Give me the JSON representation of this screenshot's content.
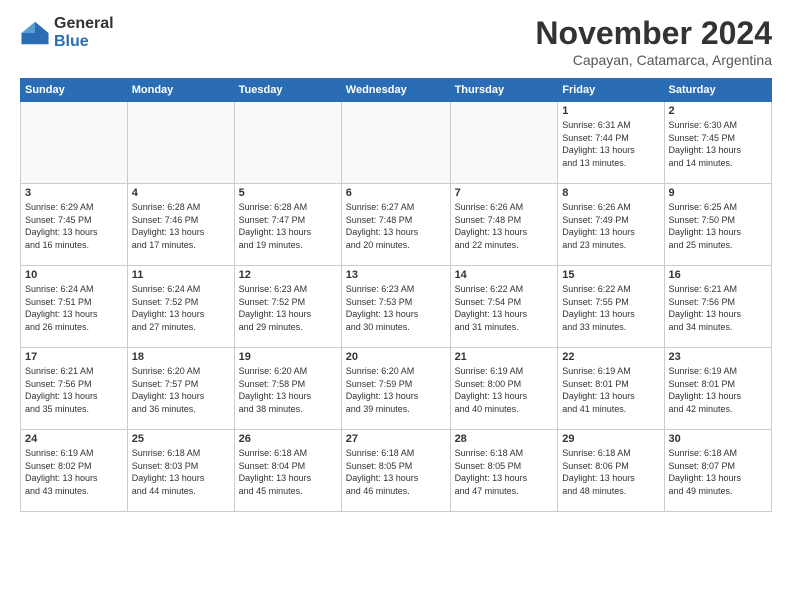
{
  "logo": {
    "general": "General",
    "blue": "Blue"
  },
  "header": {
    "month": "November 2024",
    "location": "Capayan, Catamarca, Argentina"
  },
  "weekdays": [
    "Sunday",
    "Monday",
    "Tuesday",
    "Wednesday",
    "Thursday",
    "Friday",
    "Saturday"
  ],
  "weeks": [
    [
      {
        "day": "",
        "info": ""
      },
      {
        "day": "",
        "info": ""
      },
      {
        "day": "",
        "info": ""
      },
      {
        "day": "",
        "info": ""
      },
      {
        "day": "",
        "info": ""
      },
      {
        "day": "1",
        "info": "Sunrise: 6:31 AM\nSunset: 7:44 PM\nDaylight: 13 hours\nand 13 minutes."
      },
      {
        "day": "2",
        "info": "Sunrise: 6:30 AM\nSunset: 7:45 PM\nDaylight: 13 hours\nand 14 minutes."
      }
    ],
    [
      {
        "day": "3",
        "info": "Sunrise: 6:29 AM\nSunset: 7:45 PM\nDaylight: 13 hours\nand 16 minutes."
      },
      {
        "day": "4",
        "info": "Sunrise: 6:28 AM\nSunset: 7:46 PM\nDaylight: 13 hours\nand 17 minutes."
      },
      {
        "day": "5",
        "info": "Sunrise: 6:28 AM\nSunset: 7:47 PM\nDaylight: 13 hours\nand 19 minutes."
      },
      {
        "day": "6",
        "info": "Sunrise: 6:27 AM\nSunset: 7:48 PM\nDaylight: 13 hours\nand 20 minutes."
      },
      {
        "day": "7",
        "info": "Sunrise: 6:26 AM\nSunset: 7:48 PM\nDaylight: 13 hours\nand 22 minutes."
      },
      {
        "day": "8",
        "info": "Sunrise: 6:26 AM\nSunset: 7:49 PM\nDaylight: 13 hours\nand 23 minutes."
      },
      {
        "day": "9",
        "info": "Sunrise: 6:25 AM\nSunset: 7:50 PM\nDaylight: 13 hours\nand 25 minutes."
      }
    ],
    [
      {
        "day": "10",
        "info": "Sunrise: 6:24 AM\nSunset: 7:51 PM\nDaylight: 13 hours\nand 26 minutes."
      },
      {
        "day": "11",
        "info": "Sunrise: 6:24 AM\nSunset: 7:52 PM\nDaylight: 13 hours\nand 27 minutes."
      },
      {
        "day": "12",
        "info": "Sunrise: 6:23 AM\nSunset: 7:52 PM\nDaylight: 13 hours\nand 29 minutes."
      },
      {
        "day": "13",
        "info": "Sunrise: 6:23 AM\nSunset: 7:53 PM\nDaylight: 13 hours\nand 30 minutes."
      },
      {
        "day": "14",
        "info": "Sunrise: 6:22 AM\nSunset: 7:54 PM\nDaylight: 13 hours\nand 31 minutes."
      },
      {
        "day": "15",
        "info": "Sunrise: 6:22 AM\nSunset: 7:55 PM\nDaylight: 13 hours\nand 33 minutes."
      },
      {
        "day": "16",
        "info": "Sunrise: 6:21 AM\nSunset: 7:56 PM\nDaylight: 13 hours\nand 34 minutes."
      }
    ],
    [
      {
        "day": "17",
        "info": "Sunrise: 6:21 AM\nSunset: 7:56 PM\nDaylight: 13 hours\nand 35 minutes."
      },
      {
        "day": "18",
        "info": "Sunrise: 6:20 AM\nSunset: 7:57 PM\nDaylight: 13 hours\nand 36 minutes."
      },
      {
        "day": "19",
        "info": "Sunrise: 6:20 AM\nSunset: 7:58 PM\nDaylight: 13 hours\nand 38 minutes."
      },
      {
        "day": "20",
        "info": "Sunrise: 6:20 AM\nSunset: 7:59 PM\nDaylight: 13 hours\nand 39 minutes."
      },
      {
        "day": "21",
        "info": "Sunrise: 6:19 AM\nSunset: 8:00 PM\nDaylight: 13 hours\nand 40 minutes."
      },
      {
        "day": "22",
        "info": "Sunrise: 6:19 AM\nSunset: 8:01 PM\nDaylight: 13 hours\nand 41 minutes."
      },
      {
        "day": "23",
        "info": "Sunrise: 6:19 AM\nSunset: 8:01 PM\nDaylight: 13 hours\nand 42 minutes."
      }
    ],
    [
      {
        "day": "24",
        "info": "Sunrise: 6:19 AM\nSunset: 8:02 PM\nDaylight: 13 hours\nand 43 minutes."
      },
      {
        "day": "25",
        "info": "Sunrise: 6:18 AM\nSunset: 8:03 PM\nDaylight: 13 hours\nand 44 minutes."
      },
      {
        "day": "26",
        "info": "Sunrise: 6:18 AM\nSunset: 8:04 PM\nDaylight: 13 hours\nand 45 minutes."
      },
      {
        "day": "27",
        "info": "Sunrise: 6:18 AM\nSunset: 8:05 PM\nDaylight: 13 hours\nand 46 minutes."
      },
      {
        "day": "28",
        "info": "Sunrise: 6:18 AM\nSunset: 8:05 PM\nDaylight: 13 hours\nand 47 minutes."
      },
      {
        "day": "29",
        "info": "Sunrise: 6:18 AM\nSunset: 8:06 PM\nDaylight: 13 hours\nand 48 minutes."
      },
      {
        "day": "30",
        "info": "Sunrise: 6:18 AM\nSunset: 8:07 PM\nDaylight: 13 hours\nand 49 minutes."
      }
    ]
  ]
}
